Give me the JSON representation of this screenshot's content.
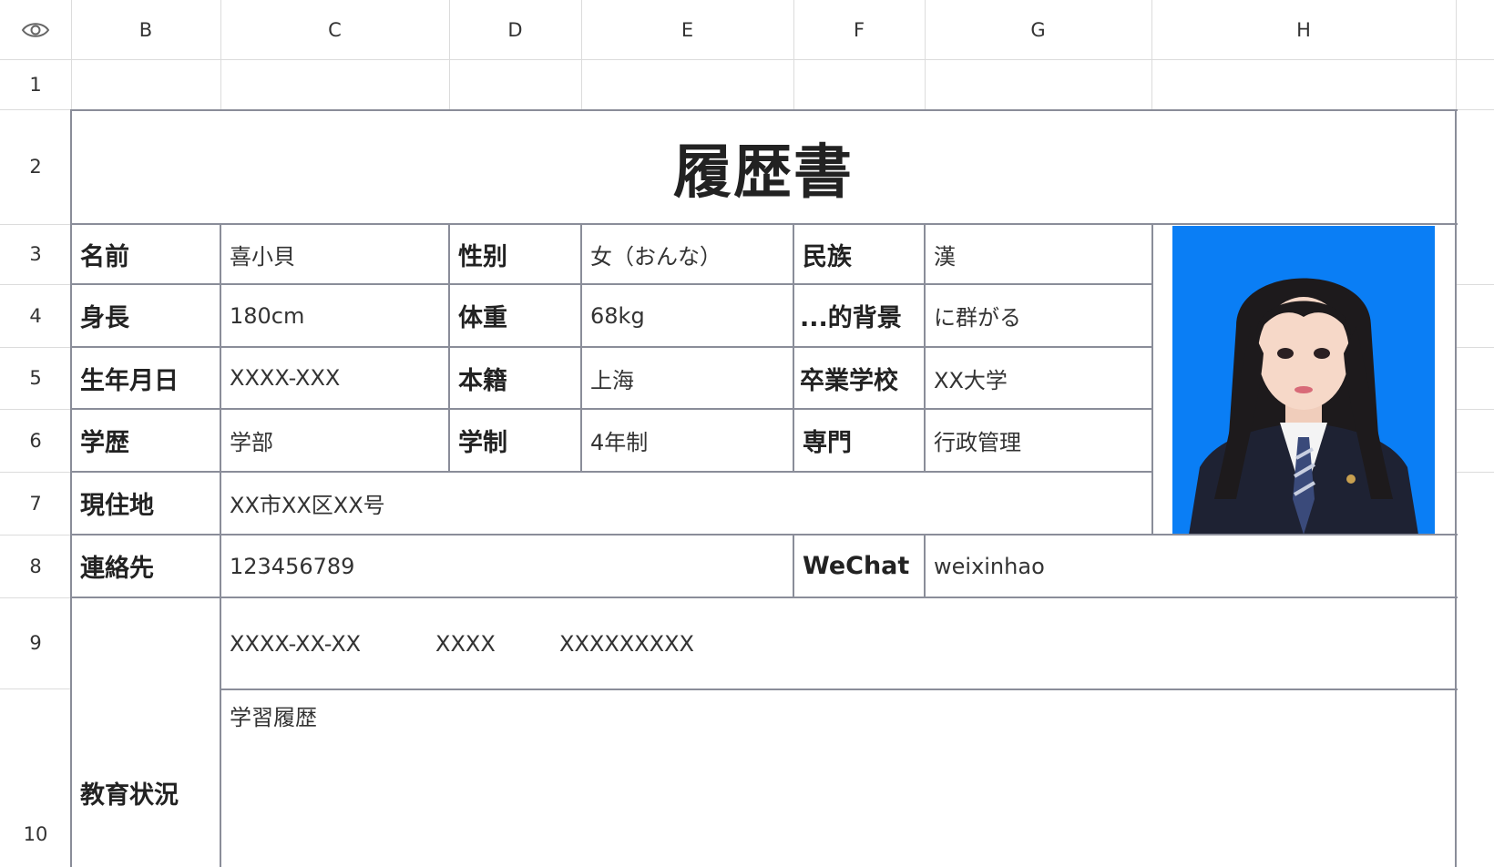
{
  "columns": [
    "B",
    "C",
    "D",
    "E",
    "F",
    "G",
    "H"
  ],
  "rows": [
    "1",
    "2",
    "3",
    "4",
    "5",
    "6",
    "7",
    "8",
    "9",
    "10"
  ],
  "title": "履歴書",
  "fields": {
    "name_label": "名前",
    "name_value": "喜小貝",
    "gender_label": "性别",
    "gender_value": "女（おんな）",
    "ethnicity_label": "民族",
    "ethnicity_value": "漢",
    "height_label": "身長",
    "height_value": "180cm",
    "weight_label": "体重",
    "weight_value": "68kg",
    "background_label": "...的背景",
    "background_value": "に群がる",
    "birth_label": "生年月日",
    "birth_value": "XXXX-XXX",
    "origin_label": "本籍",
    "origin_value": "上海",
    "school_label": "卒業学校",
    "school_value": "XX大学",
    "education_label": "学歴",
    "education_value": "学部",
    "system_label": "学制",
    "system_value": "4年制",
    "major_label": "専門",
    "major_value": "行政管理",
    "address_label": "現住地",
    "address_value": "XX市XX区XX号",
    "contact_label": "連絡先",
    "contact_value": "123456789",
    "wechat_label": "WeChat",
    "wechat_value": "weixinhao"
  },
  "education_section": {
    "label": "教育状況",
    "date": "XXXX-XX-XX",
    "col2": "XXXX",
    "col3": "XXXXXXXXX",
    "history": "学習履歴"
  },
  "colors": {
    "photo_background": "#0a7ef5",
    "border": "#8a8d99",
    "gridline": "#dcdcdc"
  },
  "icons": {
    "corner": "eye-icon"
  }
}
